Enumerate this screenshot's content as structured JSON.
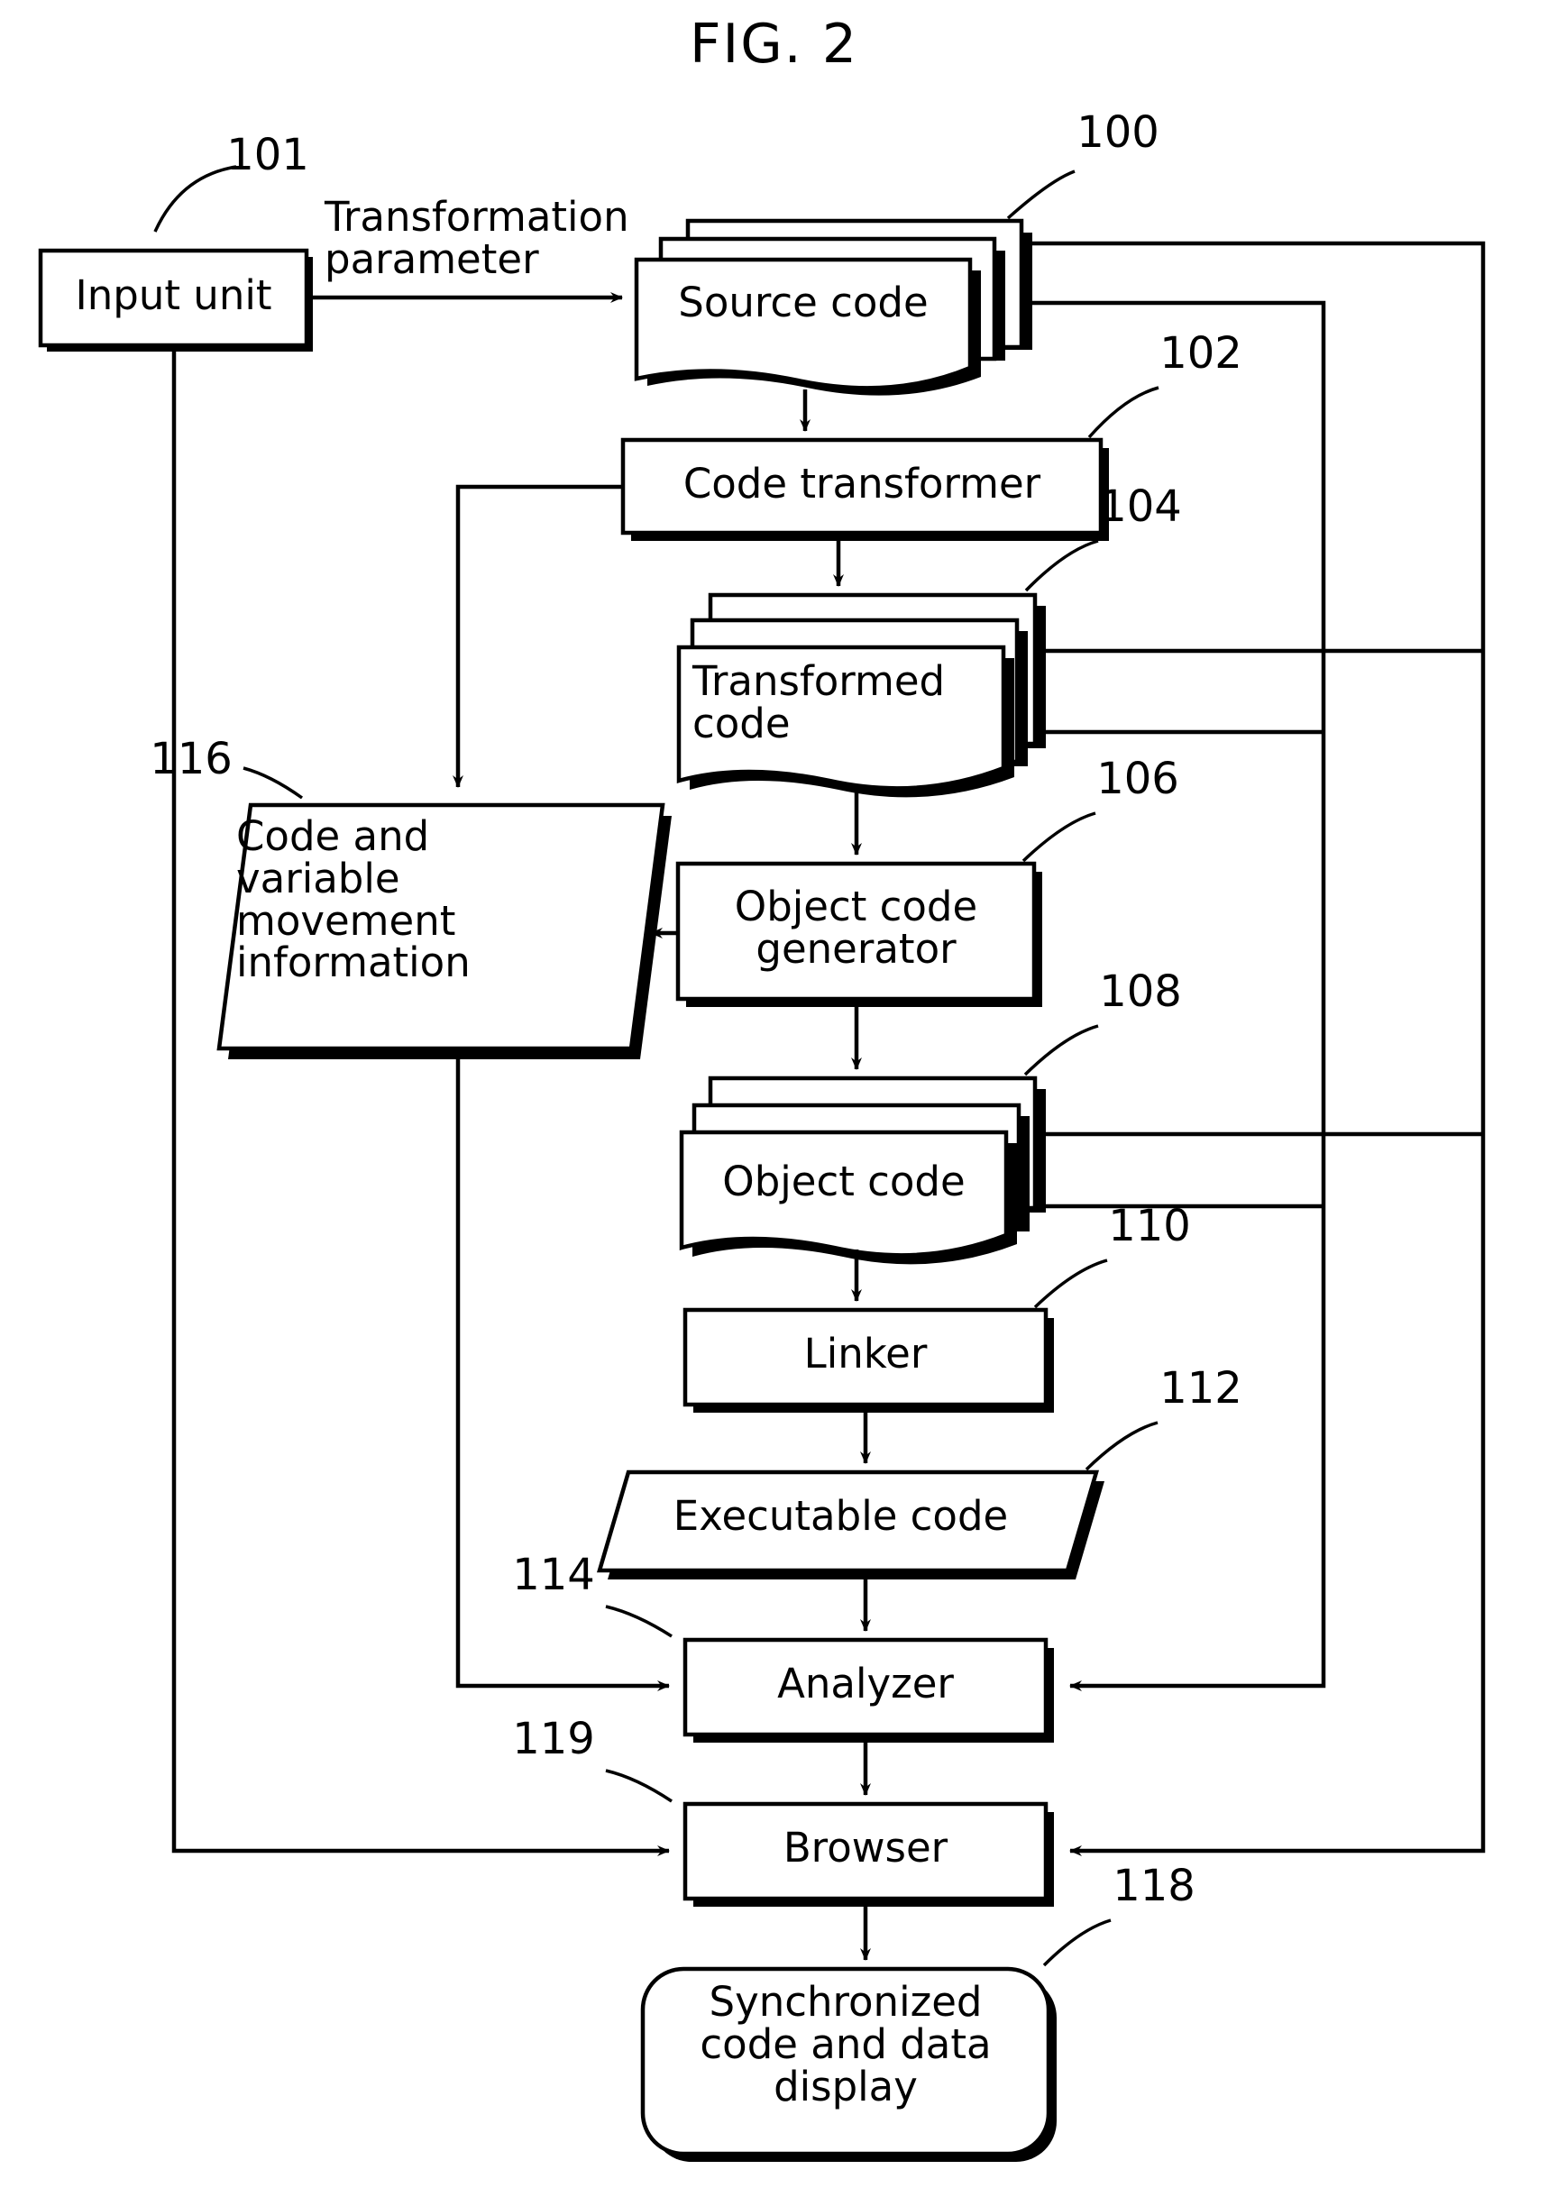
{
  "figure": {
    "title": "FIG. 2",
    "type": "patent-block-diagram"
  },
  "nodes": {
    "input_unit": {
      "ref": "101",
      "label": "Input unit",
      "shape": "rect"
    },
    "source_code": {
      "ref": "100",
      "label": "Source code",
      "shape": "stacked-document"
    },
    "code_transformer": {
      "ref": "102",
      "label": "Code transformer",
      "shape": "rect"
    },
    "transformed_code": {
      "ref": "104",
      "label": "Transformed\ncode",
      "shape": "stacked-document"
    },
    "movement_info": {
      "ref": "116",
      "label": "Code and\nvariable\nmovement\ninformation",
      "shape": "parallelogram"
    },
    "object_generator": {
      "ref": "106",
      "label": "Object code\ngenerator",
      "shape": "rect"
    },
    "object_code": {
      "ref": "108",
      "label": "Object code",
      "shape": "stacked-document"
    },
    "linker": {
      "ref": "110",
      "label": "Linker",
      "shape": "rect"
    },
    "executable_code": {
      "ref": "112",
      "label": "Executable code",
      "shape": "parallelogram"
    },
    "analyzer": {
      "ref": "114",
      "label": "Analyzer",
      "shape": "rect"
    },
    "browser": {
      "ref": "119",
      "label": "Browser",
      "shape": "rect"
    },
    "sync_display": {
      "ref": "118",
      "label": "Synchronized\ncode and data\ndisplay",
      "shape": "rounded-rect"
    }
  },
  "edges": {
    "transformation_parameter": "Transformation\nparameter"
  },
  "colors": {
    "line": "#000000",
    "fill": "#ffffff",
    "shadow": "#000000"
  }
}
